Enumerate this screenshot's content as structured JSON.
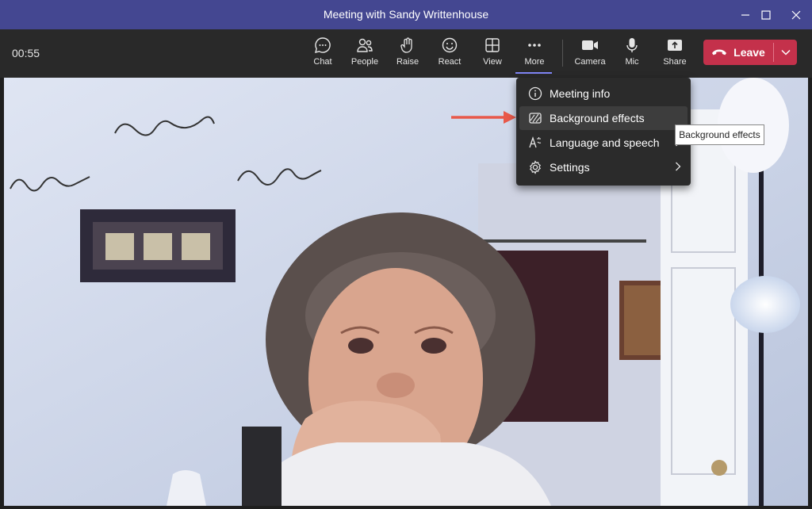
{
  "window": {
    "title": "Meeting with Sandy Writtenhouse"
  },
  "toolbar": {
    "timer": "00:55",
    "buttons": [
      {
        "label": "Chat",
        "icon": "chat-icon"
      },
      {
        "label": "People",
        "icon": "people-icon"
      },
      {
        "label": "Raise",
        "icon": "raise-hand-icon"
      },
      {
        "label": "React",
        "icon": "react-icon"
      },
      {
        "label": "View",
        "icon": "view-grid-icon"
      },
      {
        "label": "More",
        "icon": "more-icon"
      },
      {
        "label": "Camera",
        "icon": "camera-icon"
      },
      {
        "label": "Mic",
        "icon": "mic-icon"
      },
      {
        "label": "Share",
        "icon": "share-icon"
      }
    ],
    "leave_label": "Leave"
  },
  "more_menu": {
    "items": [
      {
        "label": "Meeting info",
        "icon": "info-icon"
      },
      {
        "label": "Background effects",
        "icon": "background-effects-icon"
      },
      {
        "label": "Language and speech",
        "icon": "language-icon"
      },
      {
        "label": "Settings",
        "icon": "gear-icon"
      }
    ]
  },
  "tooltip": {
    "text": "Background effects"
  },
  "colors": {
    "titlebar": "#444791",
    "toolbar": "#292929",
    "leave": "#c4314b",
    "menu": "#2b2b2b",
    "arrow": "#e8594a"
  }
}
